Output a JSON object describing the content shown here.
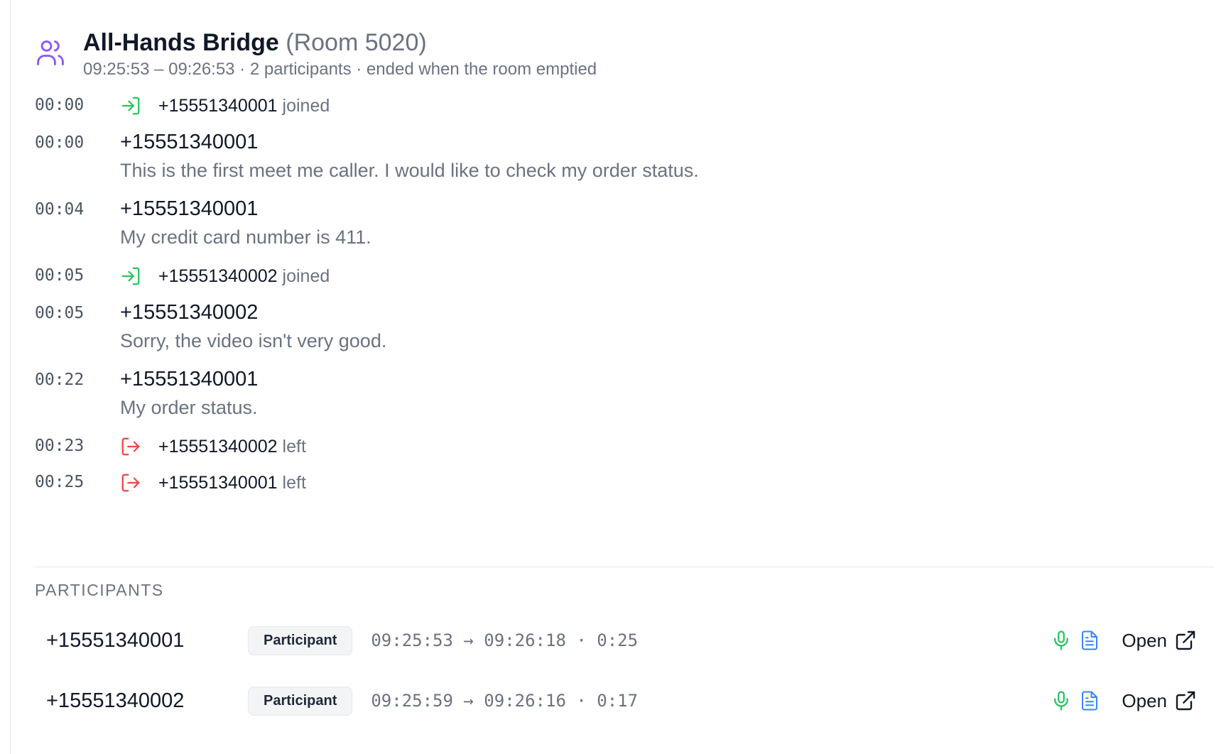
{
  "header": {
    "title": "All-Hands Bridge",
    "room": "(Room 5020)",
    "subtitle": "09:25:53 – 09:26:53 · 2 participants · ended when the room emptied",
    "icon": "users-icon"
  },
  "timeline": [
    {
      "time": "00:00",
      "kind": "event",
      "icon": "join-icon",
      "name": "+15551340001",
      "verb": "joined"
    },
    {
      "time": "00:00",
      "kind": "message",
      "speaker": "+15551340001",
      "text": "This is the first meet me caller. I would like to check my order status."
    },
    {
      "time": "00:04",
      "kind": "message",
      "speaker": "+15551340001",
      "text": "My credit card number is 411."
    },
    {
      "time": "00:05",
      "kind": "event",
      "icon": "join-icon",
      "name": "+15551340002",
      "verb": "joined"
    },
    {
      "time": "00:05",
      "kind": "message",
      "speaker": "+15551340002",
      "text": "Sorry, the video isn't very good."
    },
    {
      "time": "00:22",
      "kind": "message",
      "speaker": "+15551340001",
      "text": "My order status."
    },
    {
      "time": "00:23",
      "kind": "event",
      "icon": "leave-icon",
      "name": "+15551340002",
      "verb": "left"
    },
    {
      "time": "00:25",
      "kind": "event",
      "icon": "leave-icon",
      "name": "+15551340001",
      "verb": "left"
    }
  ],
  "participants": {
    "title": "PARTICIPANTS",
    "rows": [
      {
        "number": "+15551340001",
        "role": "Participant",
        "times": "09:25:53 → 09:26:18 · 0:25",
        "open_label": "Open"
      },
      {
        "number": "+15551340002",
        "role": "Participant",
        "times": "09:25:59 → 09:26:16 · 0:17",
        "open_label": "Open"
      }
    ]
  },
  "colors": {
    "accent": "#8b5cf6",
    "join": "#22c55e",
    "leave": "#ef4444",
    "recording": "#22c55e",
    "transcript": "#3b82f6"
  }
}
